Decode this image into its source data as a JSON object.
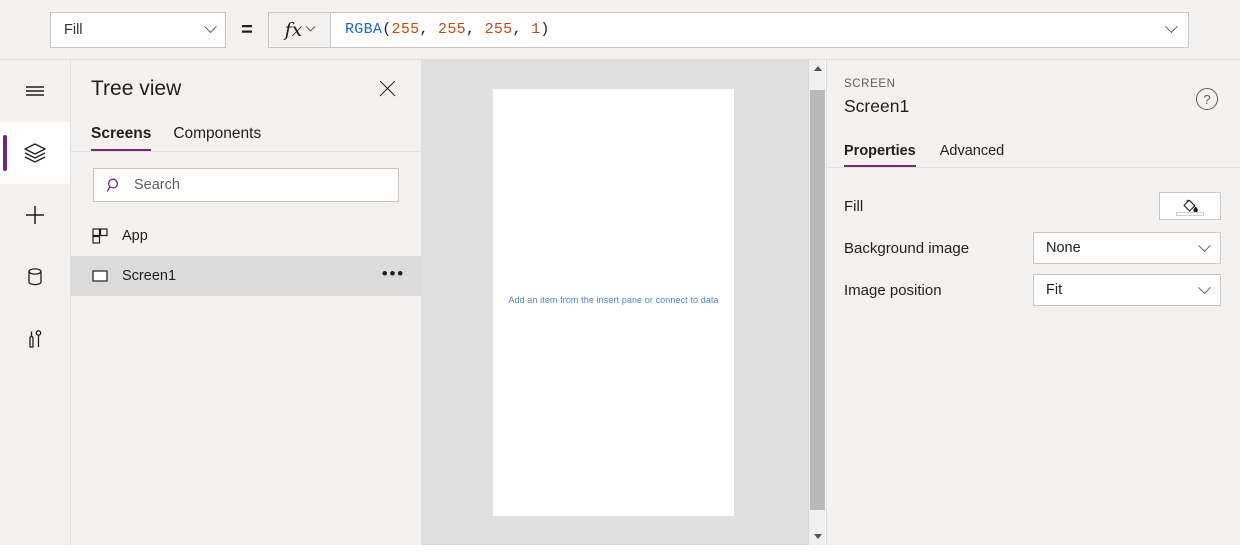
{
  "formula_bar": {
    "property_select": {
      "value": "Fill",
      "icon": "chevron-down-icon"
    },
    "equals": "=",
    "fx_label": "fx",
    "formula": {
      "function_name": "RGBA",
      "open_paren": "(",
      "args": [
        "255",
        "255",
        "255",
        "1"
      ],
      "close_paren": ")",
      "full_text": "RGBA(255, 255, 255, 1)"
    }
  },
  "rail": {
    "items": [
      {
        "name": "hamburger-menu",
        "icon": "hamburger-icon",
        "active": false
      },
      {
        "name": "tree-view",
        "icon": "layers-icon",
        "active": true
      },
      {
        "name": "insert",
        "icon": "plus-icon",
        "active": false
      },
      {
        "name": "data",
        "icon": "database-icon",
        "active": false
      },
      {
        "name": "tools",
        "icon": "tools-icon",
        "active": false
      }
    ]
  },
  "tree_view": {
    "title": "Tree view",
    "close_label": "close-icon",
    "tabs": [
      {
        "label": "Screens",
        "active": true
      },
      {
        "label": "Components",
        "active": false
      }
    ],
    "search": {
      "placeholder": "Search",
      "value": "",
      "icon": "search-icon"
    },
    "items": [
      {
        "label": "App",
        "icon": "app-grid-icon",
        "selected": false,
        "has_menu": false
      },
      {
        "label": "Screen1",
        "icon": "screen-rect-icon",
        "selected": true,
        "has_menu": true,
        "menu_label": "•••"
      }
    ]
  },
  "canvas": {
    "hint_text": "Add an item from the insert pane or connect to data",
    "scrollbar": {
      "up": "scroll-up-arrow",
      "down": "scroll-down-arrow"
    }
  },
  "properties": {
    "kicker": "SCREEN",
    "name": "Screen1",
    "help_glyph": "?",
    "tabs": [
      {
        "label": "Properties",
        "active": true
      },
      {
        "label": "Advanced",
        "active": false
      }
    ],
    "rows": [
      {
        "label": "Fill",
        "control": "color",
        "value": "#ffffff"
      },
      {
        "label": "Background image",
        "control": "dropdown",
        "value": "None"
      },
      {
        "label": "Image position",
        "control": "dropdown",
        "value": "Fit"
      }
    ]
  },
  "colors": {
    "accent": "#742774",
    "panel_bg": "#f3f2f1",
    "canvas_bg": "#e0e0e0",
    "selected_row": "#dcdcdc",
    "formula_fn": "#1a68c2",
    "formula_num": "#c14a16",
    "hint_text": "#4a86c8"
  }
}
